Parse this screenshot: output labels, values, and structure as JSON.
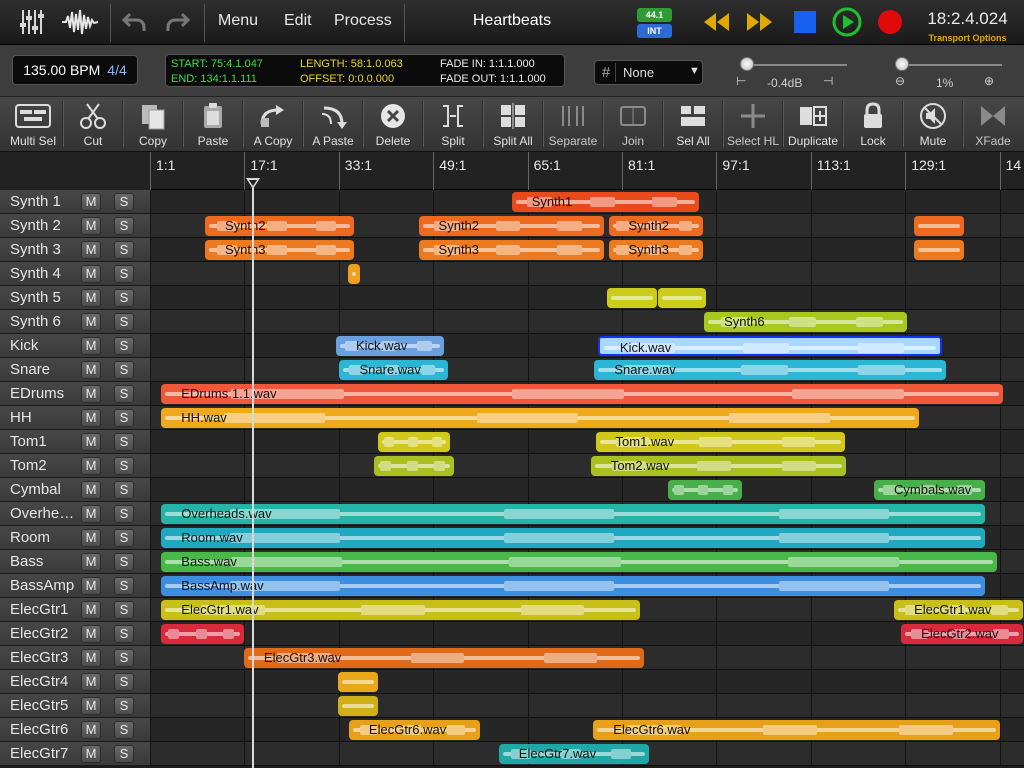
{
  "toolbar_top": {
    "menus": [
      "Menu",
      "Edit",
      "Process"
    ],
    "title": "Heartbeats",
    "sample_rate": "44.1",
    "clock_source": "INT",
    "time": "18:2.4.024",
    "transport_options": "Transport Options"
  },
  "info": {
    "bpm": "135.00 BPM",
    "time_signature": "4/4",
    "start": "START: 75:4.1.047",
    "end": "END: 134:1.1.111",
    "length": "LENGTH: 58:1.0.063",
    "offset": "OFFSET: 0:0.0.000",
    "fade_in": "FADE IN: 1:1.1.000",
    "fade_out": "FADE OUT: 1:1.1.000",
    "grid": "None",
    "volume": "-0.4dB",
    "zoom": "1%"
  },
  "tools": [
    {
      "label": "Multi Sel",
      "icon": "multi-select-icon"
    },
    {
      "label": "Cut",
      "icon": "scissors-icon"
    },
    {
      "label": "Copy",
      "icon": "copy-icon"
    },
    {
      "label": "Paste",
      "icon": "clipboard-icon"
    },
    {
      "label": "A Copy",
      "icon": "arrow-copy-icon"
    },
    {
      "label": "A Paste",
      "icon": "arrow-paste-icon"
    },
    {
      "label": "Delete",
      "icon": "delete-icon"
    },
    {
      "label": "Split",
      "icon": "split-icon"
    },
    {
      "label": "Split All",
      "icon": "split-all-icon"
    },
    {
      "label": "Separate",
      "icon": "separate-icon"
    },
    {
      "label": "Join",
      "icon": "join-icon"
    },
    {
      "label": "Sel All",
      "icon": "select-all-icon"
    },
    {
      "label": "Select HL",
      "icon": "select-highlight-icon"
    },
    {
      "label": "Duplicate",
      "icon": "duplicate-icon"
    },
    {
      "label": "Lock",
      "icon": "lock-icon"
    },
    {
      "label": "Mute",
      "icon": "mute-icon"
    },
    {
      "label": "XFade",
      "icon": "crossfade-icon"
    }
  ],
  "ruler": [
    "1:1",
    "17:1",
    "33:1",
    "49:1",
    "65:1",
    "81:1",
    "97:1",
    "113:1",
    "129:1",
    "14"
  ],
  "mute_label": "M",
  "solo_label": "S",
  "tracks": [
    {
      "name": "Synth 1",
      "clips": [
        {
          "start": 61.3,
          "end": 93.1,
          "label": "Synth1",
          "color": "#e84a1c"
        }
      ]
    },
    {
      "name": "Synth 2",
      "clips": [
        {
          "start": 9.3,
          "end": 34.5,
          "label": "Synth2",
          "color": "#ee6a1f"
        },
        {
          "start": 45.5,
          "end": 76.9,
          "label": "Synth2",
          "color": "#ee6a1f"
        },
        {
          "start": 77.7,
          "end": 93.7,
          "label": "Synth2",
          "color": "#ee6a1f"
        },
        {
          "start": 129.5,
          "end": 137.9,
          "label": "",
          "color": "#ee6a1f"
        }
      ]
    },
    {
      "name": "Synth 3",
      "clips": [
        {
          "start": 9.3,
          "end": 34.5,
          "label": "Synth3",
          "color": "#ee7a1f"
        },
        {
          "start": 45.5,
          "end": 76.9,
          "label": "Synth3",
          "color": "#ee7a1f"
        },
        {
          "start": 77.7,
          "end": 93.7,
          "label": "Synth3",
          "color": "#ee7a1f"
        },
        {
          "start": 129.5,
          "end": 137.9,
          "label": "",
          "color": "#ee7a1f"
        }
      ]
    },
    {
      "name": "Synth 4",
      "clips": [
        {
          "start": 33.6,
          "end": 35.5,
          "label": "",
          "color": "#f0a020"
        }
      ]
    },
    {
      "name": "Synth 5",
      "clips": [
        {
          "start": 77.5,
          "end": 86.0,
          "label": "",
          "color": "#cccc1a"
        },
        {
          "start": 86.0,
          "end": 94.3,
          "label": "",
          "color": "#cccc1a"
        }
      ]
    },
    {
      "name": "Synth 6",
      "clips": [
        {
          "start": 93.9,
          "end": 128.3,
          "label": "Synth6",
          "color": "#a8c820"
        }
      ]
    },
    {
      "name": "Kick",
      "clips": [
        {
          "start": 31.5,
          "end": 49.9,
          "label": "Kick.wav",
          "color": "#6aa0e0"
        },
        {
          "start": 75.9,
          "end": 134.3,
          "label": "Kick.wav",
          "color": "#a8d8ff",
          "selected": true
        }
      ]
    },
    {
      "name": "Snare",
      "clips": [
        {
          "start": 32.1,
          "end": 50.5,
          "label": "Snare.wav",
          "color": "#2cb6d6"
        },
        {
          "start": 75.3,
          "end": 134.9,
          "label": "Snare.wav",
          "color": "#2cb6d6"
        }
      ]
    },
    {
      "name": "EDrums",
      "clips": [
        {
          "start": 1.9,
          "end": 144.5,
          "label": "EDrums 1.1.wav",
          "color": "#f0583a"
        }
      ]
    },
    {
      "name": "HH",
      "clips": [
        {
          "start": 1.9,
          "end": 130.3,
          "label": "HH.wav",
          "color": "#f0a81c"
        }
      ]
    },
    {
      "name": "Tom1",
      "clips": [
        {
          "start": 38.7,
          "end": 50.9,
          "label": "",
          "color": "#d0c81a"
        },
        {
          "start": 75.5,
          "end": 117.7,
          "label": "Tom1.wav",
          "color": "#d0c81a"
        }
      ]
    },
    {
      "name": "Tom2",
      "clips": [
        {
          "start": 37.9,
          "end": 51.5,
          "label": "",
          "color": "#a8c020"
        },
        {
          "start": 74.7,
          "end": 117.9,
          "label": "Tom2.wav",
          "color": "#a8c020"
        }
      ]
    },
    {
      "name": "Cymbal",
      "clips": [
        {
          "start": 87.7,
          "end": 100.3,
          "label": "",
          "color": "#48b048"
        },
        {
          "start": 122.7,
          "end": 141.5,
          "label": "Cymbals.wav",
          "color": "#48b048"
        }
      ]
    },
    {
      "name": "Overheads",
      "clips": [
        {
          "start": 1.9,
          "end": 141.5,
          "label": "Overheads.wav",
          "color": "#24b4a8"
        }
      ]
    },
    {
      "name": "Room",
      "clips": [
        {
          "start": 1.9,
          "end": 141.5,
          "label": "Room.wav",
          "color": "#20a8c0"
        }
      ]
    },
    {
      "name": "Bass",
      "clips": [
        {
          "start": 1.9,
          "end": 143.5,
          "label": "Bass.wav",
          "color": "#48b848"
        }
      ]
    },
    {
      "name": "BassAmp",
      "clips": [
        {
          "start": 1.9,
          "end": 141.5,
          "label": "BassAmp.wav",
          "color": "#3c8ee0"
        }
      ]
    },
    {
      "name": "ElecGtr1",
      "clips": [
        {
          "start": 1.9,
          "end": 83.1,
          "label": "ElecGtr1.wav",
          "color": "#c8c018"
        },
        {
          "start": 126.1,
          "end": 148.0,
          "label": "ElecGtr1.wav",
          "color": "#c8c018"
        }
      ]
    },
    {
      "name": "ElecGtr2",
      "clips": [
        {
          "start": 1.9,
          "end": 15.9,
          "label": "",
          "color": "#d82a3c"
        },
        {
          "start": 127.3,
          "end": 148.0,
          "label": "ElecGtr2.wav",
          "color": "#d82a3c"
        }
      ]
    },
    {
      "name": "ElecGtr3",
      "clips": [
        {
          "start": 15.9,
          "end": 83.7,
          "label": "ElecGtr3.wav",
          "color": "#e06a18"
        }
      ]
    },
    {
      "name": "ElecGtr4",
      "clips": [
        {
          "start": 31.9,
          "end": 38.7,
          "label": "",
          "color": "#e8a818"
        }
      ]
    },
    {
      "name": "ElecGtr5",
      "clips": [
        {
          "start": 31.9,
          "end": 38.7,
          "label": "",
          "color": "#d0b018"
        }
      ]
    },
    {
      "name": "ElecGtr6",
      "clips": [
        {
          "start": 33.7,
          "end": 55.9,
          "label": "ElecGtr6.wav",
          "color": "#e8a018"
        },
        {
          "start": 75.1,
          "end": 144.1,
          "label": "ElecGtr6.wav",
          "color": "#e8a018"
        }
      ]
    },
    {
      "name": "ElecGtr7",
      "clips": [
        {
          "start": 59.1,
          "end": 84.5,
          "label": "ElecGtr7.wav",
          "color": "#20a8a8"
        }
      ]
    }
  ]
}
